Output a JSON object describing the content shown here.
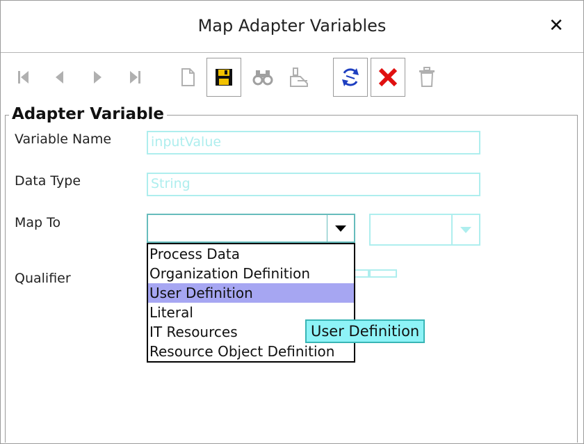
{
  "dialog": {
    "title": "Map Adapter Variables",
    "close_label": "✕"
  },
  "toolbar": {
    "buttons": [
      {
        "name": "first-record",
        "icon": "skip-first-icon"
      },
      {
        "name": "previous-record",
        "icon": "prev-icon"
      },
      {
        "name": "next-record",
        "icon": "next-icon"
      },
      {
        "name": "last-record",
        "icon": "skip-last-icon"
      },
      {
        "name": "new",
        "icon": "new-document-icon"
      },
      {
        "name": "save",
        "icon": "floppy-save-icon"
      },
      {
        "name": "query",
        "icon": "binoculars-icon"
      },
      {
        "name": "clear-query",
        "icon": "eraser-icon"
      },
      {
        "name": "refresh",
        "icon": "refresh-icon"
      },
      {
        "name": "cancel",
        "icon": "red-x-icon"
      },
      {
        "name": "delete",
        "icon": "trash-icon"
      }
    ]
  },
  "form": {
    "legend": "Adapter Variable",
    "variable_name_label": "Variable Name",
    "variable_name_value": "inputValue",
    "data_type_label": "Data Type",
    "data_type_value": "String",
    "map_to_label": "Map To",
    "map_to_value": "",
    "qualifier_label": "Qualifier"
  },
  "dropdown": {
    "options": [
      "Process Data",
      "Organization Definition",
      "User Definition",
      "Literal",
      "IT Resources",
      "Resource Object Definition"
    ],
    "highlighted": "User Definition"
  },
  "tooltip": {
    "text": "User Definition"
  },
  "colors": {
    "disabled_field": "#aeeeee",
    "highlight": "#a6a6f2",
    "tooltip_bg": "#8ef3f7"
  }
}
